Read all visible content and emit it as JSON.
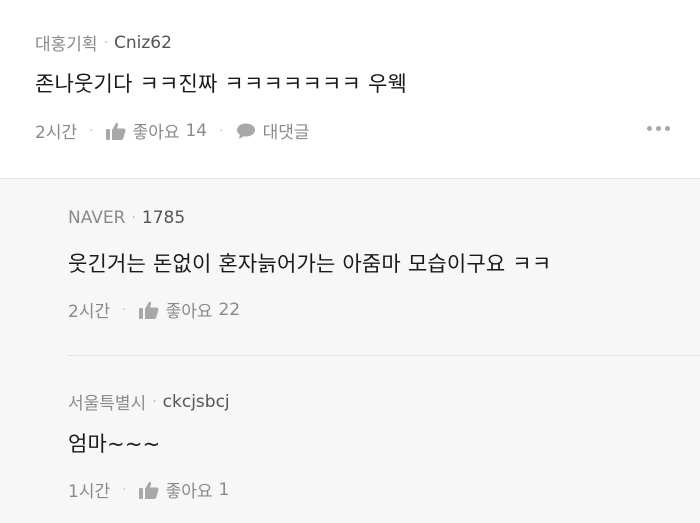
{
  "comment": {
    "source": "대홍기획",
    "user_id": "Cniz62",
    "text": "존나웃기다 ㅋㅋ진짜 ㅋㅋㅋㅋㅋㅋㅋ 우웩",
    "time": "2시간",
    "like_label": "좋아요",
    "like_count": "14",
    "reply_label": "대댓글"
  },
  "replies": [
    {
      "source": "NAVER",
      "user_id": "1785",
      "text": "웃긴거는 돈없이 혼자늙어가는 아줌마 모습이구요 ㅋㅋ",
      "time": "2시간",
      "like_label": "좋아요",
      "like_count": "22"
    },
    {
      "source": "서울특별시",
      "user_id": "ckcjsbcj",
      "text": "엄마~~~",
      "time": "1시간",
      "like_label": "좋아요",
      "like_count": "1"
    }
  ],
  "colors": {
    "meta_text": "#8a8a8a",
    "body_text": "#1a1a1a",
    "reply_background": "#f7f7f7",
    "divider": "#e2e2e2"
  },
  "icons": {
    "like": "thumbs-up-icon",
    "reply": "speech-bubble-icon",
    "more": "more-dots-icon"
  }
}
